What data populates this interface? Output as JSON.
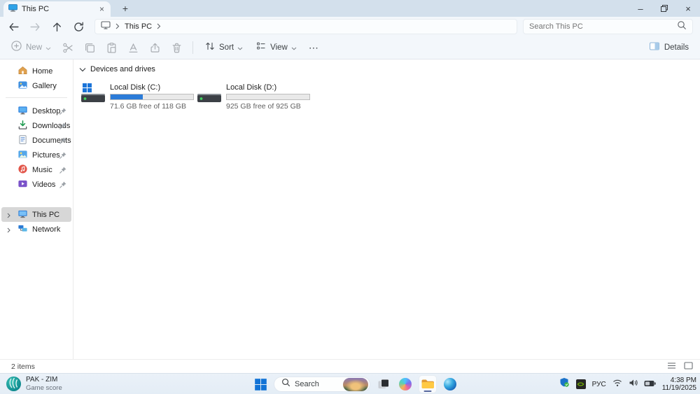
{
  "tab": {
    "title": "This PC"
  },
  "glyphs": {
    "tab_close": "×",
    "new_tab": "+",
    "minimize": "–",
    "close": "×"
  },
  "nav": {
    "path_root": "This PC",
    "search_placeholder": "Search This PC"
  },
  "toolbar": {
    "new_label": "New",
    "sort_label": "Sort",
    "view_label": "View",
    "more_label": "⋯",
    "details_label": "Details"
  },
  "sidebar": {
    "quick": [
      {
        "label": "Home"
      },
      {
        "label": "Gallery"
      }
    ],
    "pinned": [
      {
        "label": "Desktop"
      },
      {
        "label": "Downloads"
      },
      {
        "label": "Documents"
      },
      {
        "label": "Pictures"
      },
      {
        "label": "Music"
      },
      {
        "label": "Videos"
      }
    ],
    "tree": [
      {
        "label": "This PC",
        "selected": true
      },
      {
        "label": "Network",
        "selected": false
      }
    ]
  },
  "content": {
    "group": "Devices and drives",
    "drives": [
      {
        "name": "Local Disk (C:)",
        "free": "71.6 GB free of 118 GB",
        "used_percent": 39
      },
      {
        "name": "Local Disk (D:)",
        "free": "925 GB free of 925 GB",
        "used_percent": 0
      }
    ]
  },
  "status": {
    "count": "2 items"
  },
  "taskbar": {
    "widget": {
      "title": "PAK - ZIM",
      "subtitle": "Game score"
    },
    "search_label": "Search",
    "language": "РУС",
    "clock": {
      "time": "4:38 PM",
      "date": "11/19/2025"
    }
  },
  "colors": {
    "accent": "#2b7bd8",
    "titlebar": "#d3e0ec",
    "chrome": "#f3f7fb",
    "selection": "#d7d7d7",
    "taskbar": "#e9f0f7"
  }
}
